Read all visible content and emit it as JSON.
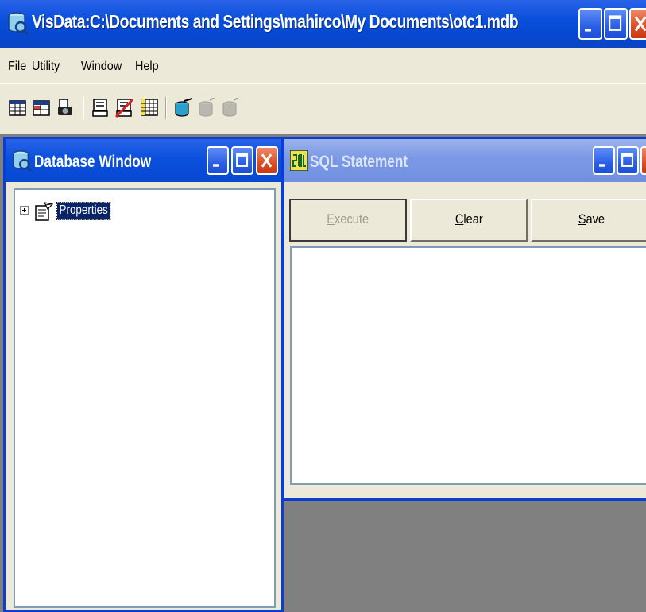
{
  "app": {
    "title": "VisData:C:\\Documents and Settings\\mahirco\\My Documents\\otc1.mdb",
    "window_controls": [
      "minimize-icon",
      "maximize-icon",
      "close-icon"
    ]
  },
  "menu": {
    "items": [
      {
        "label": "File"
      },
      {
        "label": "Utility"
      },
      {
        "label": "Window"
      },
      {
        "label": "Help"
      }
    ]
  },
  "toolbar": {
    "buttons": [
      {
        "icon": "table-type-icon"
      },
      {
        "icon": "dynaset-type-icon"
      },
      {
        "icon": "snapshot-type-icon"
      },
      {
        "icon": "data-control-form-icon"
      },
      {
        "icon": "no-data-control-form-icon"
      },
      {
        "icon": "dbgrid-form-icon"
      },
      {
        "icon": "begin-transaction-icon"
      },
      {
        "icon": "rollback-icon"
      },
      {
        "icon": "commit-icon"
      }
    ]
  },
  "database_window": {
    "title": "Database Window",
    "tree": [
      {
        "label": "Properties",
        "expanded": false,
        "selected": true,
        "icon": "properties-icon"
      }
    ]
  },
  "sql_window": {
    "title": "SQL Statement",
    "buttons": {
      "execute_pre": "",
      "execute_mnemonic": "E",
      "execute_post": "xecute",
      "clear_pre": "",
      "clear_mnemonic": "C",
      "clear_post": "lear",
      "save_pre": "",
      "save_mnemonic": "S",
      "save_post": "ave"
    },
    "query_text": ""
  },
  "colors": {
    "title_active": "#0a50dc",
    "title_inactive": "#7b98e6",
    "mdi_background": "#808080",
    "selection": "#0a246a"
  }
}
